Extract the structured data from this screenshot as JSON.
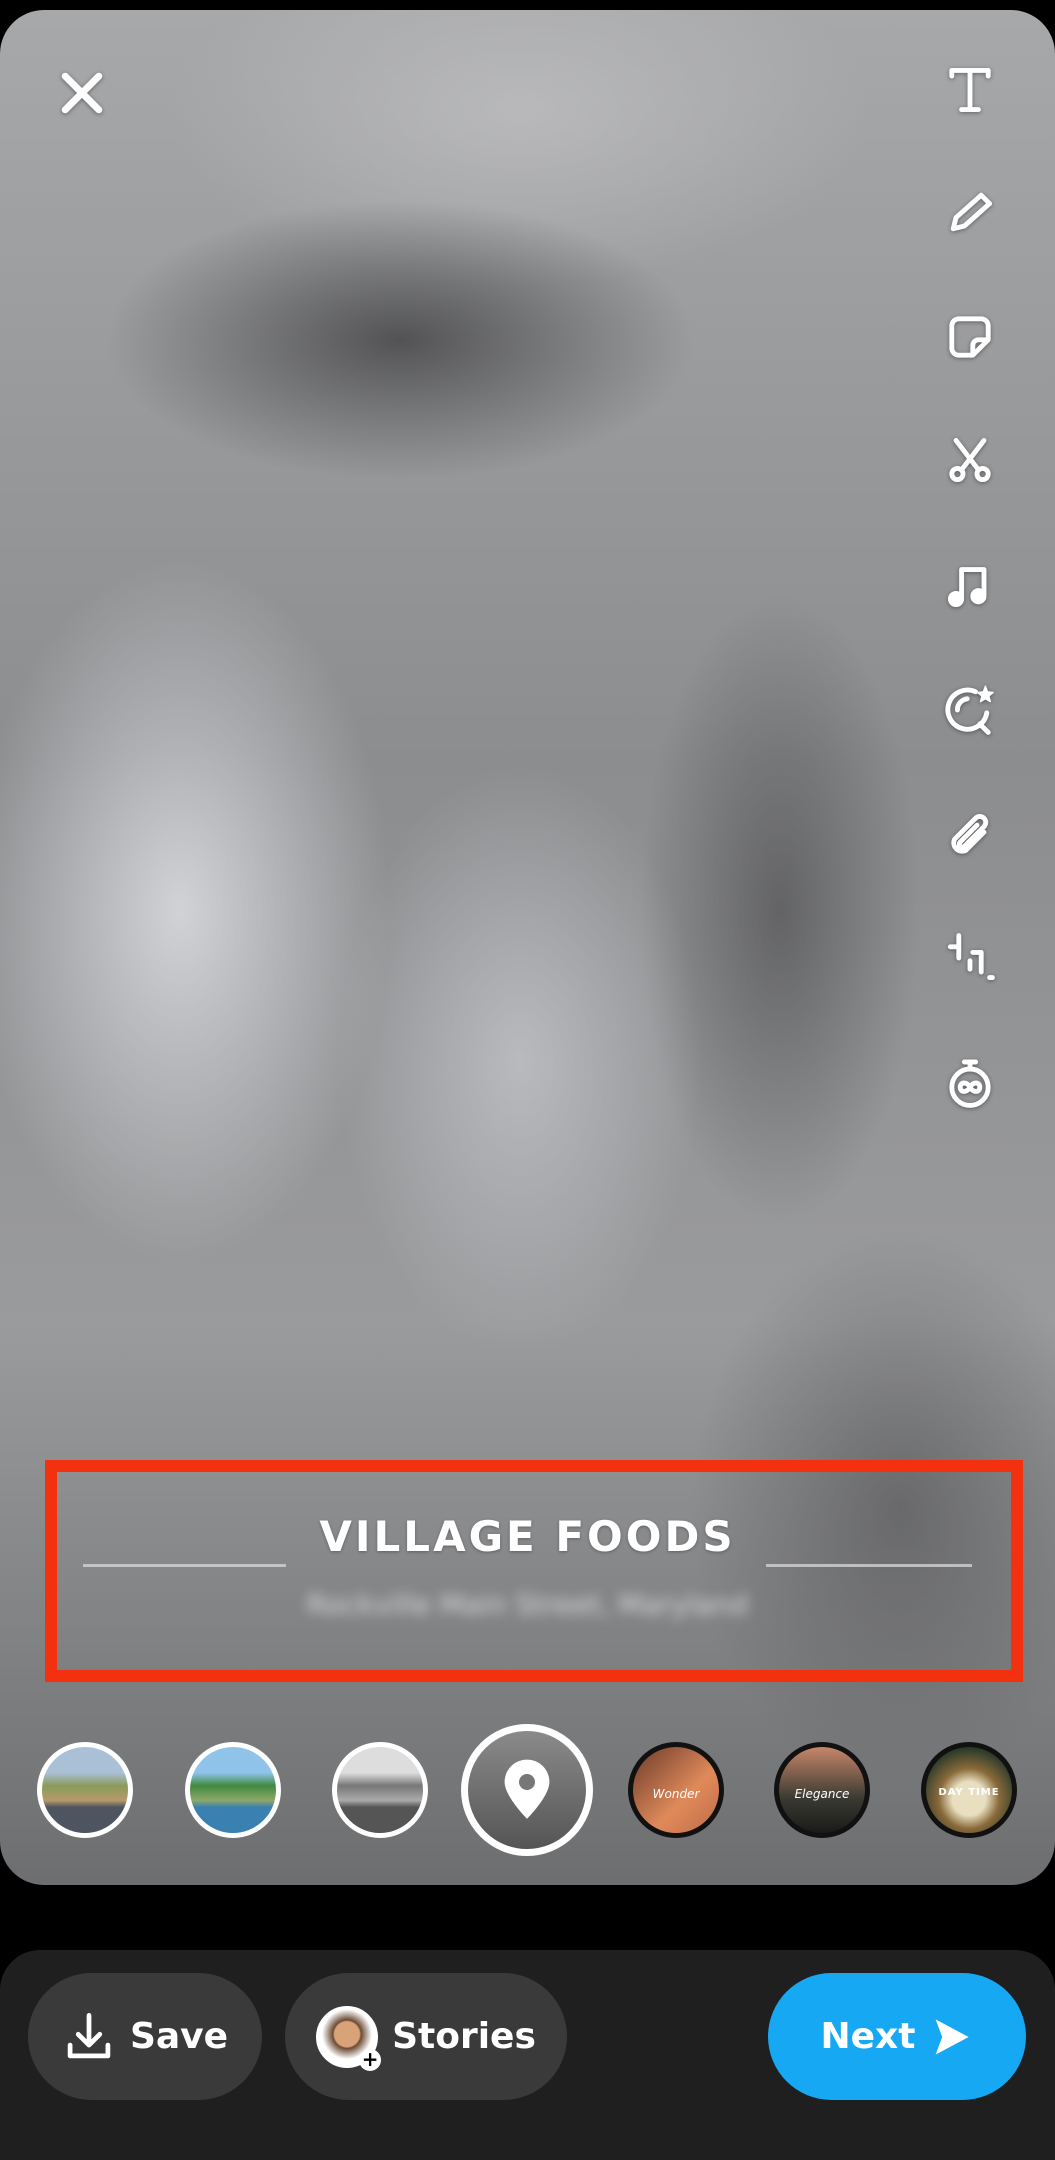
{
  "close_icon": "close-icon",
  "toolbar": [
    "text-icon",
    "pencil-icon",
    "sticker-icon",
    "scissors-icon",
    "music-icon",
    "lens-star-icon",
    "paperclip-icon",
    "crop-icon",
    "timer-icon"
  ],
  "overlay": {
    "venue_name": "VILLAGE FOODS",
    "subtitle": "Rockville Main Street, Maryland"
  },
  "filters": [
    {
      "name": "filter-landscape-warm"
    },
    {
      "name": "filter-landscape-vivid"
    },
    {
      "name": "filter-landscape-bw"
    },
    {
      "name": "filter-location",
      "icon": "location-pin-icon"
    },
    {
      "name": "filter-wonder",
      "label": "Wonder"
    },
    {
      "name": "filter-elegance",
      "label": "Elegance"
    },
    {
      "name": "filter-daytime",
      "label": "DAY TIME"
    }
  ],
  "actions": {
    "save": "Save",
    "stories": "Stories",
    "next": "Next"
  },
  "colors": {
    "highlight": "#f3300f",
    "next_button": "#17a8f4",
    "bar": "#1f1f1f"
  }
}
